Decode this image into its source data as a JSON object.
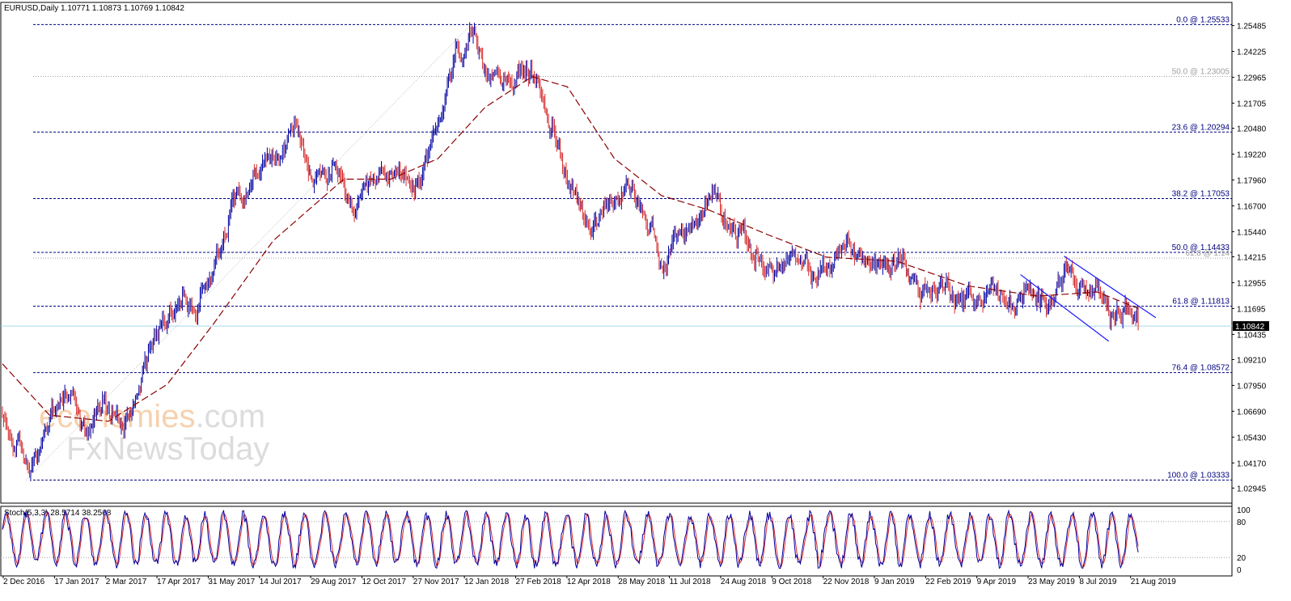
{
  "header": {
    "symbol_label": "EURUSD,Daily",
    "ohlc_label": "1.10771 1.10873 1.10769 1.10842"
  },
  "indicator": {
    "label": "Stoch(5,3,3) 28.5714 38.2568",
    "levels": [
      "100",
      "80",
      "20",
      "0"
    ]
  },
  "watermark": {
    "line1_a": "economies",
    "line1_b": ".com",
    "line2_a": "Fx",
    "line2_b": "NewsToday"
  },
  "colors": {
    "bull": "#0000a0",
    "bear": "#d42a2a",
    "ma": "#8b0000",
    "fib": "#00007f",
    "fib_grey": "#a0a0a0",
    "channel": "#1a1aff",
    "price_line": "#a8d8ea",
    "stoch_main": "#0000a0",
    "stoch_signal": "#e03030"
  },
  "chart_data": {
    "type": "candlestick",
    "symbol": "EURUSD",
    "timeframe": "Daily",
    "current_price": "1.10842",
    "price_axis": {
      "ticks": [
        "1.25485",
        "1.24225",
        "1.22965",
        "1.21705",
        "1.20480",
        "1.19220",
        "1.17960",
        "1.16700",
        "1.15440",
        "1.14215",
        "1.12955",
        "1.11695",
        "1.10435",
        "1.09210",
        "1.07950",
        "1.06690",
        "1.05430",
        "1.04170",
        "1.02945"
      ],
      "range": [
        1.0233,
        1.2614
      ]
    },
    "date_axis": {
      "ticks": [
        "2 Dec 2016",
        "17 Jan 2017",
        "2 Mar 2017",
        "17 Apr 2017",
        "31 May 2017",
        "14 Jul 2017",
        "29 Aug 2017",
        "12 Oct 2017",
        "27 Nov 2017",
        "12 Jan 2018",
        "27 Feb 2018",
        "12 Apr 2018",
        "28 May 2018",
        "11 Jul 2018",
        "24 Aug 2018",
        "9 Oct 2018",
        "22 Nov 2018",
        "9 Jan 2019",
        "22 Feb 2019",
        "9 Apr 2019",
        "23 May 2019",
        "8 Jul 2019",
        "21 Aug 2019"
      ]
    },
    "fibonacci_levels": [
      {
        "label": "0.0 @ 1.25533",
        "price": 1.25533,
        "style": "dashed-blue"
      },
      {
        "label": "50.0 @ 1.23005",
        "price": 1.23005,
        "style": "dotted-grey"
      },
      {
        "label": "23.6 @ 1.20294",
        "price": 1.20294,
        "style": "dashed-blue"
      },
      {
        "label": "38.2 @ 1.17053",
        "price": 1.17053,
        "style": "dashed-blue"
      },
      {
        "label": "50.0 @ 1.14433",
        "price": 1.14433,
        "style": "dashed-blue"
      },
      {
        "label": "61.8 @ 1.14",
        "price": 1.1415,
        "style": "dotted-grey"
      },
      {
        "label": "61.8 @ 1.11813",
        "price": 1.11813,
        "style": "dashed-blue"
      },
      {
        "label": "76.4 @ 1.08572",
        "price": 1.08572,
        "style": "dashed-blue"
      },
      {
        "label": "100.0 @ 1.03333",
        "price": 1.03333,
        "style": "dashed-blue"
      }
    ],
    "price_anchors": [
      {
        "date_index": 0,
        "price": 1.062
      },
      {
        "date_index": 12,
        "price": 1.05
      },
      {
        "date_index": 23,
        "price": 1.038
      },
      {
        "date_index": 40,
        "price": 1.063
      },
      {
        "date_index": 58,
        "price": 1.077
      },
      {
        "date_index": 70,
        "price": 1.057
      },
      {
        "date_index": 85,
        "price": 1.07
      },
      {
        "date_index": 105,
        "price": 1.063
      },
      {
        "date_index": 120,
        "price": 1.09
      },
      {
        "date_index": 135,
        "price": 1.11
      },
      {
        "date_index": 150,
        "price": 1.124
      },
      {
        "date_index": 165,
        "price": 1.115
      },
      {
        "date_index": 180,
        "price": 1.14
      },
      {
        "date_index": 200,
        "price": 1.175
      },
      {
        "date_index": 220,
        "price": 1.185
      },
      {
        "date_index": 240,
        "price": 1.195
      },
      {
        "date_index": 250,
        "price": 1.205
      },
      {
        "date_index": 262,
        "price": 1.18
      },
      {
        "date_index": 280,
        "price": 1.185
      },
      {
        "date_index": 300,
        "price": 1.163
      },
      {
        "date_index": 320,
        "price": 1.178
      },
      {
        "date_index": 340,
        "price": 1.185
      },
      {
        "date_index": 355,
        "price": 1.175
      },
      {
        "date_index": 370,
        "price": 1.205
      },
      {
        "date_index": 385,
        "price": 1.24
      },
      {
        "date_index": 398,
        "price": 1.25
      },
      {
        "date_index": 410,
        "price": 1.225
      },
      {
        "date_index": 420,
        "price": 1.235
      },
      {
        "date_index": 435,
        "price": 1.23
      },
      {
        "date_index": 450,
        "price": 1.232
      },
      {
        "date_index": 462,
        "price": 1.215
      },
      {
        "date_index": 475,
        "price": 1.19
      },
      {
        "date_index": 490,
        "price": 1.17
      },
      {
        "date_index": 505,
        "price": 1.155
      },
      {
        "date_index": 520,
        "price": 1.17
      },
      {
        "date_index": 535,
        "price": 1.175
      },
      {
        "date_index": 550,
        "price": 1.16
      },
      {
        "date_index": 562,
        "price": 1.138
      },
      {
        "date_index": 578,
        "price": 1.155
      },
      {
        "date_index": 592,
        "price": 1.16
      },
      {
        "date_index": 605,
        "price": 1.175
      },
      {
        "date_index": 612,
        "price": 1.165
      },
      {
        "date_index": 625,
        "price": 1.155
      },
      {
        "date_index": 640,
        "price": 1.143
      },
      {
        "date_index": 655,
        "price": 1.135
      },
      {
        "date_index": 670,
        "price": 1.14
      },
      {
        "date_index": 690,
        "price": 1.132
      },
      {
        "date_index": 705,
        "price": 1.14
      },
      {
        "date_index": 718,
        "price": 1.148
      },
      {
        "date_index": 735,
        "price": 1.14
      },
      {
        "date_index": 750,
        "price": 1.135
      },
      {
        "date_index": 765,
        "price": 1.143
      },
      {
        "date_index": 780,
        "price": 1.125
      },
      {
        "date_index": 795,
        "price": 1.128
      },
      {
        "date_index": 810,
        "price": 1.125
      },
      {
        "date_index": 825,
        "price": 1.12
      },
      {
        "date_index": 840,
        "price": 1.128
      },
      {
        "date_index": 855,
        "price": 1.117
      },
      {
        "date_index": 870,
        "price": 1.123
      },
      {
        "date_index": 882,
        "price": 1.118
      },
      {
        "date_index": 895,
        "price": 1.13
      },
      {
        "date_index": 905,
        "price": 1.137
      },
      {
        "date_index": 918,
        "price": 1.125
      },
      {
        "date_index": 932,
        "price": 1.121
      },
      {
        "date_index": 945,
        "price": 1.11
      },
      {
        "date_index": 955,
        "price": 1.118
      },
      {
        "date_index": 965,
        "price": 1.108
      }
    ],
    "ma_anchors": [
      {
        "date_index": 0,
        "price": 1.09
      },
      {
        "date_index": 40,
        "price": 1.065
      },
      {
        "date_index": 90,
        "price": 1.062
      },
      {
        "date_index": 140,
        "price": 1.08
      },
      {
        "date_index": 180,
        "price": 1.11
      },
      {
        "date_index": 230,
        "price": 1.15
      },
      {
        "date_index": 290,
        "price": 1.18
      },
      {
        "date_index": 330,
        "price": 1.18
      },
      {
        "date_index": 370,
        "price": 1.19
      },
      {
        "date_index": 410,
        "price": 1.215
      },
      {
        "date_index": 450,
        "price": 1.23
      },
      {
        "date_index": 480,
        "price": 1.225
      },
      {
        "date_index": 520,
        "price": 1.19
      },
      {
        "date_index": 560,
        "price": 1.172
      },
      {
        "date_index": 600,
        "price": 1.165
      },
      {
        "date_index": 650,
        "price": 1.153
      },
      {
        "date_index": 700,
        "price": 1.142
      },
      {
        "date_index": 760,
        "price": 1.14
      },
      {
        "date_index": 820,
        "price": 1.128
      },
      {
        "date_index": 880,
        "price": 1.123
      },
      {
        "date_index": 930,
        "price": 1.125
      },
      {
        "date_index": 965,
        "price": 1.117
      }
    ],
    "channel": {
      "upper": [
        {
          "date_index": 902,
          "price": 1.1425
        },
        {
          "date_index": 980,
          "price": 1.1125
        }
      ],
      "lower": [
        {
          "date_index": 865,
          "price": 1.1335
        },
        {
          "date_index": 940,
          "price": 1.101
        }
      ]
    },
    "stochastic": {
      "main_value": 28.5714,
      "signal_value": 38.2568,
      "range": [
        0,
        100
      ],
      "levels": [
        20,
        80
      ]
    }
  }
}
